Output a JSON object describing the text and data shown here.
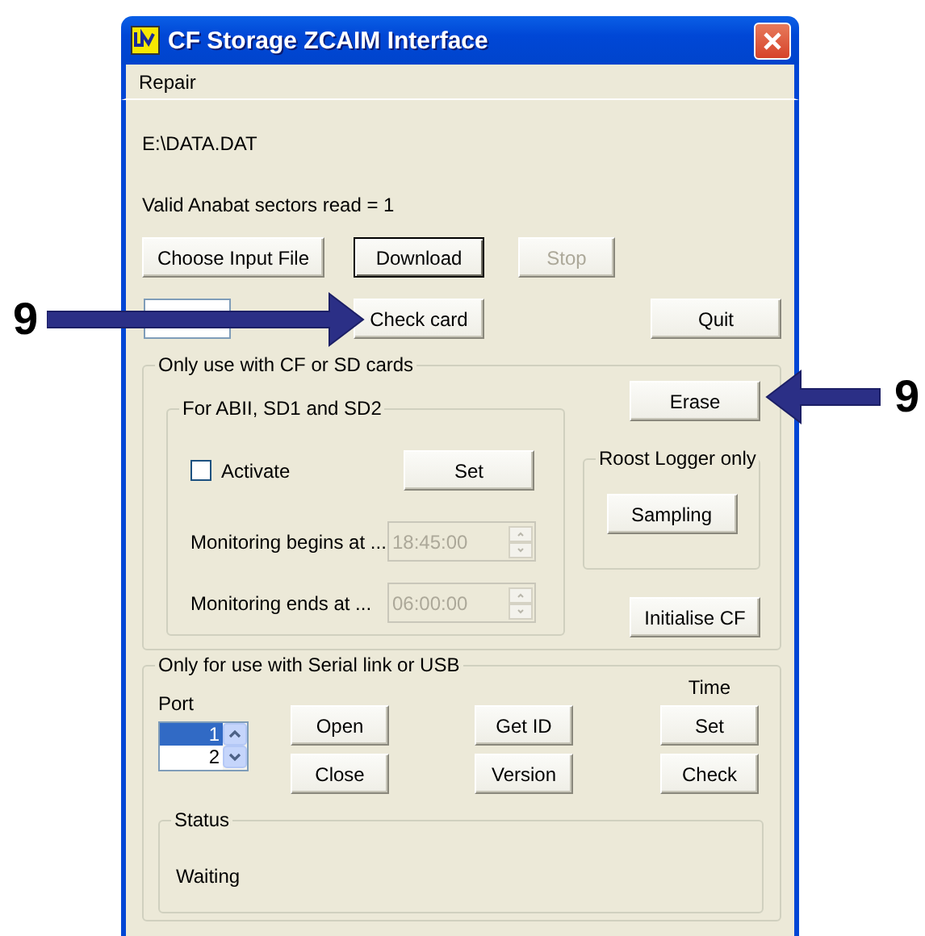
{
  "window": {
    "title": "CF Storage ZCAIM Interface"
  },
  "menu": [
    {
      "label": "Repair"
    }
  ],
  "file_path": "E:\\DATA.DAT",
  "sectors_status": "Valid Anabat sectors read = 1",
  "top_buttons": [
    {
      "label": "Choose Input File",
      "disabled": false,
      "default": false
    },
    {
      "label": "Download",
      "disabled": false,
      "default": true
    },
    {
      "label": "Stop",
      "disabled": true,
      "default": false
    }
  ],
  "check_card_button": "Check card",
  "quit_button": "Quit",
  "cf_group": {
    "title": "Only use with CF or SD cards",
    "erase_button": "Erase",
    "initialise_button": "Initialise CF",
    "abii_group": {
      "title": "For ABII, SD1 and SD2",
      "activate": {
        "label": "Activate",
        "checked": false
      },
      "set_button": "Set",
      "times": [
        {
          "label": "Monitoring begins at ...",
          "value": "18:45:00",
          "disabled": true
        },
        {
          "label": "Monitoring ends at ...",
          "value": "06:00:00",
          "disabled": true
        }
      ]
    },
    "roost_group": {
      "title": "Roost Logger only",
      "sampling_button": "Sampling"
    }
  },
  "serial_group": {
    "title": "Only for use with Serial link or USB",
    "port": {
      "label": "Port",
      "items": [
        {
          "label": "1",
          "selected": true
        },
        {
          "label": "2",
          "selected": false
        }
      ]
    },
    "open_button": "Open",
    "close_button": "Close",
    "get_id_button": "Get ID",
    "version_button": "Version",
    "time": {
      "label": "Time",
      "set_button": "Set",
      "check_button": "Check"
    },
    "status": {
      "title": "Status",
      "text": "Waiting"
    }
  },
  "left_callout": {
    "label": "9"
  },
  "right_callout": {
    "label": "9"
  }
}
